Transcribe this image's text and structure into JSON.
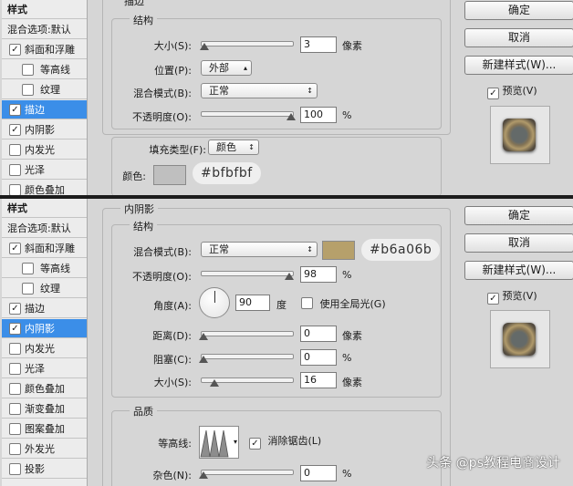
{
  "panel1": {
    "styles": {
      "header": "样式",
      "blend_options": "混合选项:默认",
      "items": [
        {
          "label": "斜面和浮雕",
          "checked": "✓"
        },
        {
          "label": "等高线",
          "checked": ""
        },
        {
          "label": "纹理",
          "checked": ""
        },
        {
          "label": "描边",
          "checked": "✓"
        },
        {
          "label": "内阴影",
          "checked": "✓"
        },
        {
          "label": "内发光",
          "checked": ""
        },
        {
          "label": "光泽",
          "checked": ""
        },
        {
          "label": "颜色叠加",
          "checked": ""
        }
      ]
    },
    "section_title": "描边",
    "structure_title": "结构",
    "size_label": "大小(S):",
    "size_value": "3",
    "size_unit": "像素",
    "position_label": "位置(P):",
    "position_value": "外部",
    "blend_label": "混合模式(B):",
    "blend_value": "正常",
    "opacity_label": "不透明度(O):",
    "opacity_value": "100",
    "opacity_unit": "%",
    "fill_type_label": "填充类型(F):",
    "fill_type_value": "颜色",
    "color_label": "颜色:",
    "color_hex": "#bfbfbf",
    "color_swatch": "#bfbfbf",
    "buttons": {
      "ok": "确定",
      "cancel": "取消",
      "new_style": "新建样式(W)...",
      "preview": "预览(V)"
    }
  },
  "panel2": {
    "styles": {
      "header": "样式",
      "blend_options": "混合选项:默认",
      "items": [
        {
          "label": "斜面和浮雕",
          "checked": "✓"
        },
        {
          "label": "等高线",
          "checked": ""
        },
        {
          "label": "纹理",
          "checked": ""
        },
        {
          "label": "描边",
          "checked": "✓"
        },
        {
          "label": "内阴影",
          "checked": "✓"
        },
        {
          "label": "内发光",
          "checked": ""
        },
        {
          "label": "光泽",
          "checked": ""
        },
        {
          "label": "颜色叠加",
          "checked": ""
        },
        {
          "label": "渐变叠加",
          "checked": ""
        },
        {
          "label": "图案叠加",
          "checked": ""
        },
        {
          "label": "外发光",
          "checked": ""
        },
        {
          "label": "投影",
          "checked": ""
        }
      ]
    },
    "section_title": "内阴影",
    "structure_title": "结构",
    "blend_label": "混合模式(B):",
    "blend_value": "正常",
    "shadow_hex": "#b6a06b",
    "shadow_swatch": "#b6a06b",
    "opacity_label": "不透明度(O):",
    "opacity_value": "98",
    "opacity_unit": "%",
    "angle_label": "角度(A):",
    "angle_value": "90",
    "angle_unit": "度",
    "global_light_label": "使用全局光(G)",
    "distance_label": "距离(D):",
    "distance_value": "0",
    "distance_unit": "像素",
    "choke_label": "阻塞(C):",
    "choke_value": "0",
    "choke_unit": "%",
    "size_label": "大小(S):",
    "size_value": "16",
    "size_unit": "像素",
    "quality_title": "品质",
    "contour_label": "等高线:",
    "anti_alias_label": "消除锯齿(L)",
    "noise_label": "杂色(N):",
    "noise_value": "0",
    "noise_unit": "%",
    "buttons": {
      "ok": "确定",
      "cancel": "取消",
      "new_style": "新建样式(W)...",
      "preview": "预览(V)"
    }
  },
  "watermark": "头条 @ps教程电商设计"
}
